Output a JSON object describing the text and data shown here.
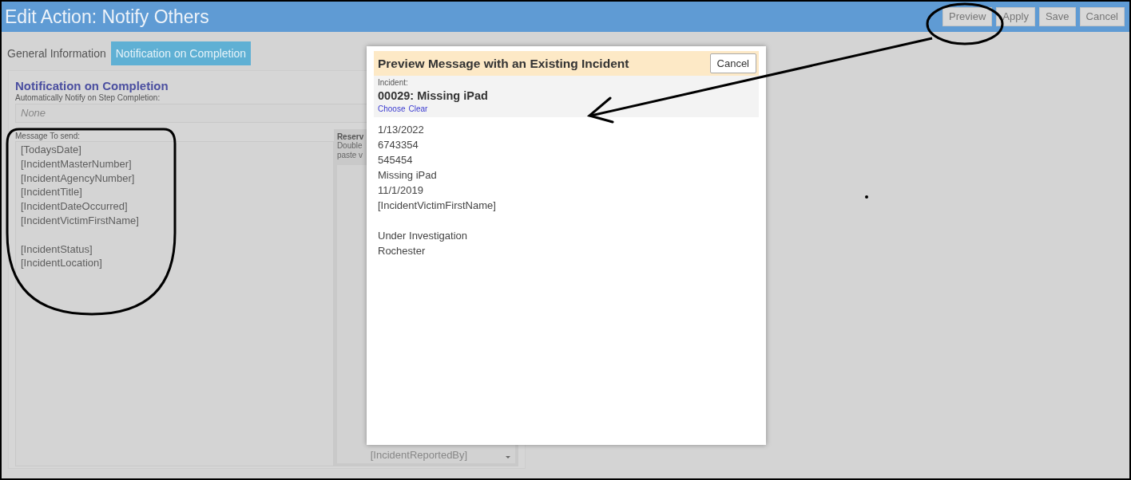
{
  "header": {
    "title": "Edit Action: Notify Others",
    "buttons": [
      "Preview",
      "Apply",
      "Save",
      "Cancel"
    ]
  },
  "tabs": [
    {
      "label": "General Information",
      "selected": false
    },
    {
      "label": "Notification on Completion",
      "selected": true
    }
  ],
  "section": {
    "heading": "Notification on Completion",
    "notify_label": "Automatically Notify on Step Completion:",
    "notify_placeholder": "None",
    "message_label": "Message To send:",
    "message_value": "[TodaysDate]\n[IncidentMasterNumber]\n[IncidentAgencyNumber]\n[IncidentTitle]\n[IncidentDateOccurred]\n[IncidentVictimFirstName]\n\n[IncidentStatus]\n[IncidentLocation]"
  },
  "reserved": {
    "title": "Reserv",
    "hint_lines": [
      "Double",
      "paste v"
    ],
    "items": [
      "[IncidentReportedBy]"
    ]
  },
  "modal": {
    "title": "Preview Message with an Existing Incident",
    "cancel": "Cancel",
    "incident_label": "Incident:",
    "incident_value": "00029: Missing iPad",
    "links": [
      "Choose",
      "Clear"
    ],
    "body": "1/13/2022\n6743354\n545454\nMissing iPad\n11/1/2019\n[IncidentVictimFirstName]\n\nUnder Investigation\nRochester"
  }
}
